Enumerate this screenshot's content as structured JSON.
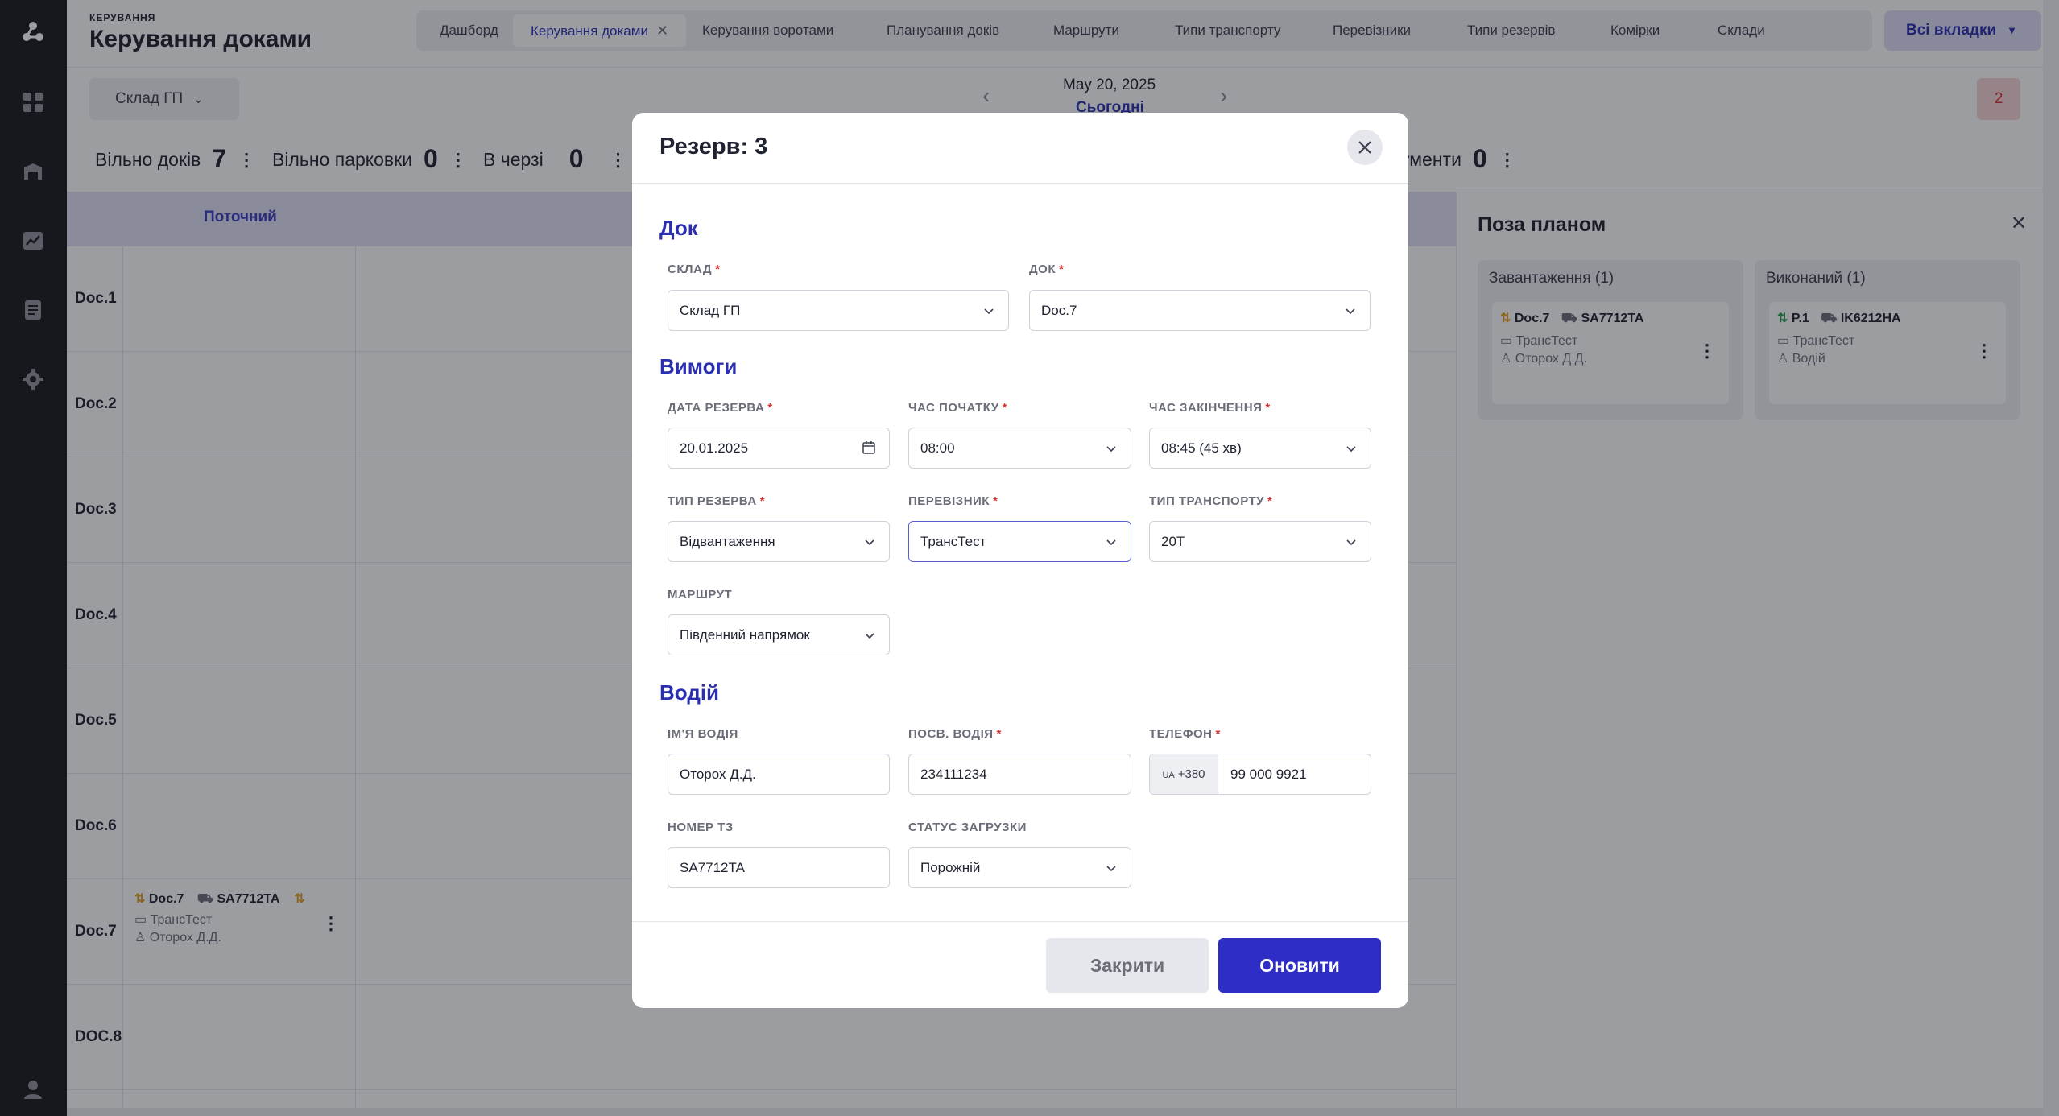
{
  "header": {
    "section_small": "КЕРУВАННЯ",
    "title": "Керування доками",
    "tabs": [
      {
        "label": "Дашборд"
      },
      {
        "label": "Керування доками",
        "active": true
      },
      {
        "label": "Керування воротами"
      },
      {
        "label": "Планування доків"
      },
      {
        "label": "Маршрути"
      },
      {
        "label": "Типи транспорту"
      },
      {
        "label": "Перевізники"
      },
      {
        "label": "Типи резервів"
      },
      {
        "label": "Комірки"
      },
      {
        "label": "Склади"
      }
    ],
    "all_tabs_label": "Всі вкладки",
    "all_tabs_caret": "▼",
    "active_tab_close": "✕"
  },
  "icons": {
    "rail": [
      "logo-icon",
      "dashboard-icon",
      "warehouse-icon",
      "analytics-icon",
      "document-icon",
      "settings-icon",
      "user-icon"
    ],
    "bell": "bell-icon"
  },
  "toolbar": {
    "warehouse_select": "Склад ГП",
    "date": "May 20, 2025",
    "today": "Сьогодні",
    "prev": "‹",
    "next": "›",
    "notifications_badge": "2"
  },
  "stats": [
    {
      "label": "Вільно доків",
      "value": "7"
    },
    {
      "label": "Вільно парковки",
      "value": "0"
    },
    {
      "label": "В черзі",
      "value": "0"
    },
    {
      "label": "ументи",
      "value": "0"
    }
  ],
  "grid": {
    "current_column": "Поточний",
    "docks": [
      "Doc.1",
      "Doc.2",
      "Doc.3",
      "Doc.4",
      "Doc.5",
      "Doc.6",
      "Doc.7",
      "DOC.8"
    ],
    "card": {
      "dock": "Doc.7",
      "plate": "SA7712TA",
      "carrier": "ТрансТест",
      "driver": "Оторох Д.Д."
    }
  },
  "side_panel": {
    "title": "Поза планом",
    "close": "✕",
    "lanes": [
      {
        "title": "Завантаження (1)",
        "card": {
          "dock": "Doc.7",
          "plate": "SA7712TA",
          "carrier": "ТрансТест",
          "driver": "Оторох Д.Д."
        }
      },
      {
        "title": "Виконаний (1)",
        "card": {
          "dock": "P.1",
          "plate": "IK6212HA",
          "carrier": "ТрансТест",
          "driver": "Водій"
        }
      }
    ]
  },
  "modal": {
    "title": "Резерв: 3",
    "sections": {
      "dock": "Док",
      "requirements": "Вимоги",
      "driver": "Водій"
    },
    "fields": {
      "warehouse": {
        "label": "СКЛАД",
        "value": "Склад ГП"
      },
      "dock": {
        "label": "ДОК",
        "value": "Doc.7"
      },
      "date": {
        "label": "ДАТА РЕЗЕРВА",
        "value": "20.01.2025"
      },
      "start": {
        "label": "ЧАС ПОЧАТКУ",
        "value": "08:00"
      },
      "end": {
        "label": "ЧАС ЗАКІНЧЕННЯ",
        "value": "08:45 (45 хв)"
      },
      "reserve_type": {
        "label": "ТИП РЕЗЕРВА",
        "value": "Відвантаження"
      },
      "carrier": {
        "label": "ПЕРЕВІЗНИК",
        "value": "ТрансТест"
      },
      "transport_type": {
        "label": "ТИП ТРАНСПОРТУ",
        "value": "20Т"
      },
      "route": {
        "label": "МАРШРУТ",
        "value": "Південний напрямок"
      },
      "driver_name": {
        "label": "ІМ'Я ВОДІЯ",
        "value": "Оторох Д.Д."
      },
      "driver_license": {
        "label": "ПОСВ. ВОДІЯ",
        "value": "234111234"
      },
      "phone": {
        "label": "ТЕЛЕФОН",
        "country": "UA",
        "code": "+380",
        "value": "99 000 9921"
      },
      "plate": {
        "label": "НОМЕР ТЗ",
        "value": "SA7712TA"
      },
      "load_status": {
        "label": "СТАТУС ЗАГРУЗКИ",
        "value": "Порожній"
      }
    },
    "required_mark": "*",
    "buttons": {
      "close": "Закрити",
      "update": "Оновити"
    }
  },
  "colors": {
    "accent": "#2e2ec6",
    "accent_light": "#dcdcf3",
    "required": "#d23333",
    "rail": "#191a1e"
  }
}
